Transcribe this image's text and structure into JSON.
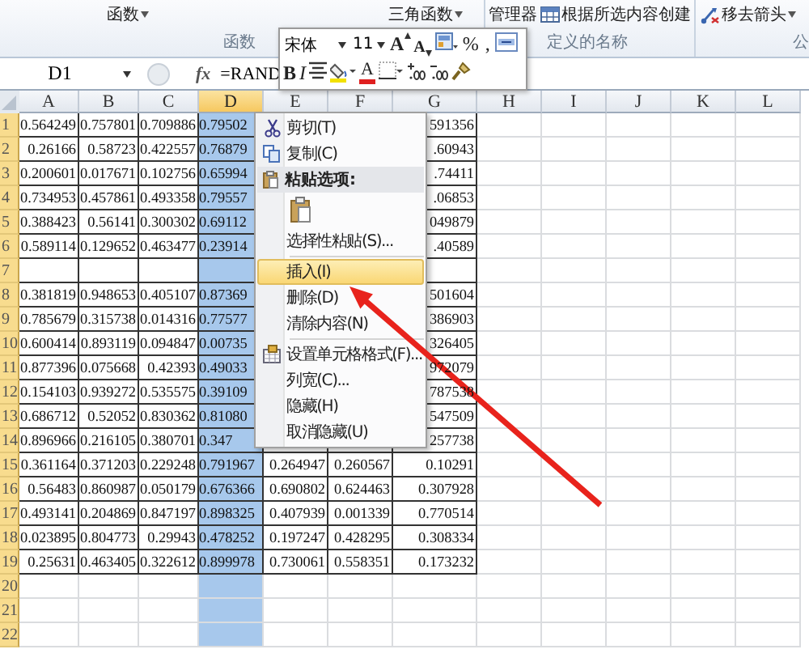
{
  "ribbon": {
    "groups": [
      {
        "label": "函数",
        "buttons": [
          {
            "label": "函数",
            "caret": true
          },
          {
            "label": "三角函数",
            "caret": true
          }
        ]
      },
      {
        "label": "定义的名称",
        "buttons": [
          {
            "label": "管理器",
            "caret": false
          },
          {
            "label": "根据所选内容创建",
            "caret": false
          }
        ]
      },
      {
        "label": "公",
        "buttons": [
          {
            "label": "移去箭头",
            "caret": true
          }
        ]
      }
    ]
  },
  "mini_toolbar": {
    "font": "宋体",
    "size": "11",
    "row1": [
      {
        "kind": "grow",
        "label": "A"
      },
      {
        "kind": "shrink",
        "label": "A"
      },
      {
        "kind": "styles"
      },
      {
        "kind": "plain",
        "label": "%"
      },
      {
        "kind": "plain",
        "label": ","
      },
      {
        "kind": "merge"
      }
    ],
    "row2": [
      {
        "kind": "bold",
        "label": "B"
      },
      {
        "kind": "italic",
        "label": "I"
      },
      {
        "kind": "center"
      },
      {
        "kind": "fill"
      },
      {
        "kind": "font-color",
        "label": "A"
      },
      {
        "kind": "border"
      },
      {
        "kind": "inc-decimal"
      },
      {
        "kind": "dec-decimal"
      },
      {
        "kind": "brush"
      }
    ]
  },
  "formula_bar": {
    "name_box": "D1",
    "function_label": "fx",
    "formula": "=RAND"
  },
  "sheet": {
    "columns": [
      {
        "label": "A",
        "selected": false
      },
      {
        "label": "B",
        "selected": false
      },
      {
        "label": "C",
        "selected": false
      },
      {
        "label": "D",
        "selected": true
      },
      {
        "label": "E",
        "selected": false
      },
      {
        "label": "F",
        "selected": false
      },
      {
        "label": "G",
        "selected": false
      },
      {
        "label": "H",
        "selected": false
      },
      {
        "label": "I",
        "selected": false
      },
      {
        "label": "J",
        "selected": false
      },
      {
        "label": "K",
        "selected": false
      },
      {
        "label": "L",
        "selected": false
      }
    ],
    "rows": [
      {
        "number": "1",
        "cells": [
          "0.564249",
          "0.757801",
          "0.709886",
          "0.79502",
          null,
          null,
          "591356"
        ]
      },
      {
        "number": "2",
        "cells": [
          "0.26166",
          "0.58723",
          "0.422557",
          "0.76879",
          null,
          null,
          ".60943"
        ]
      },
      {
        "number": "3",
        "cells": [
          "0.200601",
          "0.017671",
          "0.102756",
          "0.65994",
          null,
          null,
          ".74411"
        ]
      },
      {
        "number": "4",
        "cells": [
          "0.734953",
          "0.457861",
          "0.493358",
          "0.79557",
          null,
          null,
          ".06853"
        ]
      },
      {
        "number": "5",
        "cells": [
          "0.388423",
          "0.56141",
          "0.300302",
          "0.69112",
          null,
          null,
          "049879"
        ]
      },
      {
        "number": "6",
        "cells": [
          "0.589114",
          "0.129652",
          "0.463477",
          "0.23914",
          null,
          null,
          ".40589"
        ]
      },
      {
        "number": "7",
        "cells": [
          null,
          null,
          null,
          null,
          null,
          null,
          null
        ]
      },
      {
        "number": "8",
        "cells": [
          "0.381819",
          "0.948653",
          "0.405107",
          "0.87369",
          null,
          null,
          "501604"
        ]
      },
      {
        "number": "9",
        "cells": [
          "0.785679",
          "0.315738",
          "0.014316",
          "0.77577",
          null,
          null,
          "386903"
        ]
      },
      {
        "number": "10",
        "cells": [
          "0.600414",
          "0.893119",
          "0.094847",
          "0.00735",
          null,
          null,
          "326405"
        ]
      },
      {
        "number": "11",
        "cells": [
          "0.877396",
          "0.075668",
          "0.42393",
          "0.49033",
          null,
          null,
          "972079"
        ]
      },
      {
        "number": "12",
        "cells": [
          "0.154103",
          "0.939272",
          "0.535575",
          "0.39109",
          null,
          null,
          "787538"
        ]
      },
      {
        "number": "13",
        "cells": [
          "0.686712",
          "0.52052",
          "0.830362",
          "0.81080",
          null,
          null,
          "547509"
        ]
      },
      {
        "number": "14",
        "cells": [
          "0.896966",
          "0.216105",
          "0.380701",
          "0.347",
          null,
          null,
          "257738"
        ]
      },
      {
        "number": "15",
        "cells": [
          "0.361164",
          "0.371203",
          "0.229248",
          "0.791967",
          "0.264947",
          "0.260567",
          "0.10291"
        ]
      },
      {
        "number": "16",
        "cells": [
          "0.56483",
          "0.860987",
          "0.050179",
          "0.676366",
          "0.690802",
          "0.624463",
          "0.307928"
        ]
      },
      {
        "number": "17",
        "cells": [
          "0.493141",
          "0.204869",
          "0.847197",
          "0.898325",
          "0.407939",
          "0.001339",
          "0.770514"
        ]
      },
      {
        "number": "18",
        "cells": [
          "0.023895",
          "0.804773",
          "0.29943",
          "0.478252",
          "0.197247",
          "0.428295",
          "0.308334"
        ]
      },
      {
        "number": "19",
        "cells": [
          "0.25631",
          "0.463405",
          "0.322612",
          "0.899978",
          "0.730061",
          "0.558351",
          "0.173232"
        ]
      },
      {
        "number": "20",
        "cells": []
      },
      {
        "number": "21",
        "cells": []
      },
      {
        "number": "22",
        "cells": []
      }
    ]
  },
  "context_menu": {
    "items": [
      {
        "kind": "item",
        "label": "剪切(T)",
        "selected": false
      },
      {
        "kind": "item",
        "label": "复制(C)",
        "selected": false
      },
      {
        "kind": "header",
        "label": "粘贴选项:"
      },
      {
        "kind": "paste-options"
      },
      {
        "kind": "item",
        "label": "选择性粘贴(S)...",
        "selected": false
      },
      {
        "kind": "separator"
      },
      {
        "kind": "item",
        "label": "插入(I)",
        "selected": true
      },
      {
        "kind": "item",
        "label": "删除(D)",
        "selected": false
      },
      {
        "kind": "item",
        "label": "清除内容(N)",
        "selected": false
      },
      {
        "kind": "separator"
      },
      {
        "kind": "item",
        "label": "设置单元格格式(F)...",
        "selected": false
      },
      {
        "kind": "item",
        "label": "列宽(C)...",
        "selected": false
      },
      {
        "kind": "item",
        "label": "隐藏(H)",
        "selected": false
      },
      {
        "kind": "item",
        "label": "取消隐藏(U)",
        "selected": false
      }
    ]
  }
}
